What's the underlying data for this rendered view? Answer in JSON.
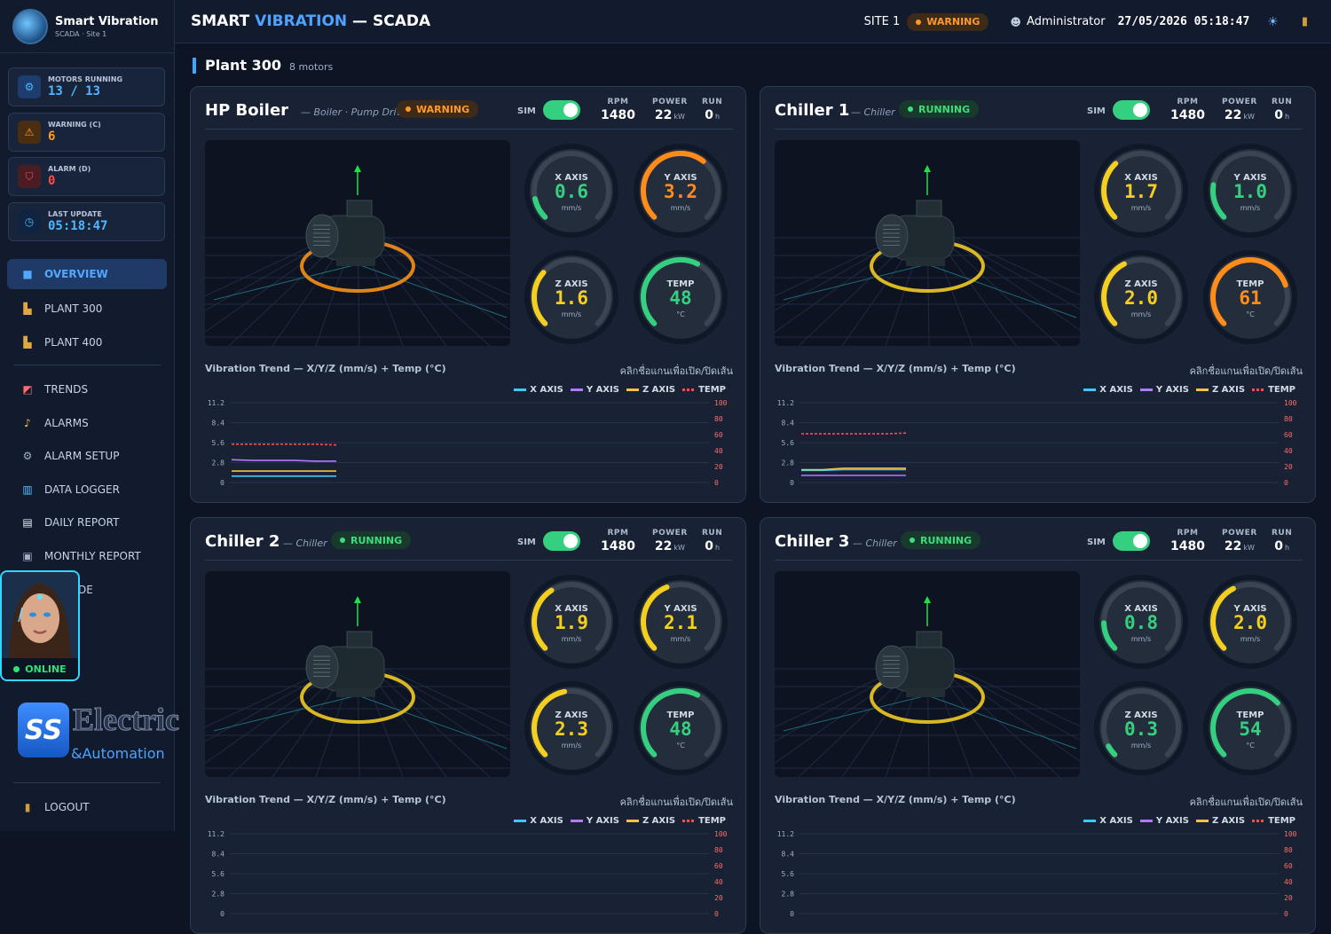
{
  "brand": {
    "title": "Smart Vibration",
    "subtitle": "SCADA · Site 1"
  },
  "stats": [
    {
      "label": "MOTORS RUNNING",
      "value": "13 / 13",
      "color": "#4fb6ff",
      "icon": "gear-icon"
    },
    {
      "label": "WARNING (C)",
      "value": "6",
      "color": "#ff9a2a",
      "icon": "warning-icon"
    },
    {
      "label": "ALARM (D)",
      "value": "0",
      "color": "#ff4a4a",
      "icon": "shield-icon"
    },
    {
      "label": "LAST UPDATE",
      "value": "05:18:47",
      "color": "#4fb6ff",
      "icon": "clock-icon"
    }
  ],
  "nav": [
    {
      "label": "OVERVIEW",
      "icon": "overview-icon"
    },
    {
      "label": "PLANT 300",
      "icon": "factory-icon"
    },
    {
      "label": "PLANT 400",
      "icon": "factory-icon"
    },
    {
      "label": "TRENDS",
      "icon": "trend-chart-icon"
    },
    {
      "label": "ALARMS",
      "icon": "bell-icon"
    },
    {
      "label": "ALARM SETUP",
      "icon": "gear-icon"
    },
    {
      "label": "DATA LOGGER",
      "icon": "bar-chart-icon"
    },
    {
      "label": "DAILY REPORT",
      "icon": "document-icon"
    },
    {
      "label": "MONTHLY REPORT",
      "icon": "calendar-icon"
    },
    {
      "label": "DE",
      "icon": ""
    }
  ],
  "assistant": {
    "status": "ONLINE"
  },
  "company": {
    "mark": "SS",
    "name": "Electric",
    "sub": "&Automation"
  },
  "logout": "LOGOUT",
  "topbar": {
    "title_a": "SMART ",
    "title_b": "VIBRATION",
    "title_c": " — SCADA",
    "site": "SITE 1",
    "status": "WARNING",
    "user": "Administrator",
    "datetime": "27/05/2026 05:18:47"
  },
  "section": {
    "title": "Plant 300",
    "subtitle": "8 motors"
  },
  "labels": {
    "sim": "SIM",
    "rpm": "RPM",
    "power": "POWER",
    "run": "RUN",
    "kw": "kW",
    "h": "h",
    "trend_title": "Vibration Trend — X/Y/Z (mm/s) + Temp (°C)",
    "trend_hint": "คลิกชื่อแกนเพื่อเปิด/ปิดเส้น",
    "x": "X AXIS",
    "y": "Y AXIS",
    "z": "Z AXIS",
    "temp": "TEMP",
    "mms": "mm/s",
    "degc": "°C"
  },
  "colors": {
    "green": "#35d07f",
    "yellow": "#f5cf1f",
    "orange": "#ff8c1a",
    "x": "#3ec8ff",
    "y": "#b27bff",
    "z": "#f5c242",
    "t": "#ff4a4a"
  },
  "chart_axes": {
    "left_ticks": [
      "11.2",
      "8.4",
      "5.6",
      "2.8",
      "0"
    ],
    "right_ticks": [
      "100",
      "80",
      "60",
      "40",
      "20",
      "0"
    ]
  },
  "motors": [
    {
      "name": "HP Boiler",
      "type": "— Boiler · Pump Drive",
      "status": "WARNING",
      "rpm": "1480",
      "power": "22",
      "run": "0",
      "x": "0.6",
      "y": "3.2",
      "z": "1.6",
      "temp": "48",
      "ring": "orange",
      "chart_data": {
        "type": "line",
        "y_range": [
          0,
          11.2
        ],
        "y2_range": [
          0,
          100
        ],
        "series": [
          {
            "name": "X AXIS",
            "values": [
              0.9,
              0.9,
              0.9,
              0.9,
              0.9,
              0.9
            ]
          },
          {
            "name": "Y AXIS",
            "values": [
              3.2,
              3.1,
              3.1,
              3.1,
              3.0,
              3.0
            ]
          },
          {
            "name": "Z AXIS",
            "values": [
              1.6,
              1.6,
              1.6,
              1.6,
              1.6,
              1.6
            ]
          },
          {
            "name": "TEMP",
            "values": [
              48,
              48,
              48,
              48,
              48,
              47
            ]
          }
        ]
      }
    },
    {
      "name": "Chiller 1",
      "type": "— Chiller",
      "status": "RUNNING",
      "rpm": "1480",
      "power": "22",
      "run": "0",
      "x": "1.7",
      "y": "1.0",
      "z": "2.0",
      "temp": "61",
      "ring": "yellow",
      "chart_data": {
        "type": "line",
        "y_range": [
          0,
          11.2
        ],
        "y2_range": [
          0,
          100
        ],
        "series": [
          {
            "name": "X AXIS",
            "values": [
              1.7,
              1.7,
              1.8,
              1.8,
              1.8,
              1.8
            ]
          },
          {
            "name": "Y AXIS",
            "values": [
              1.0,
              1.0,
              1.0,
              1.0,
              1.0,
              1.0
            ]
          },
          {
            "name": "Z AXIS",
            "values": [
              1.8,
              1.8,
              2.0,
              2.0,
              2.0,
              2.0
            ]
          },
          {
            "name": "TEMP",
            "values": [
              61,
              61,
              61,
              61,
              61,
              62
            ]
          }
        ]
      }
    },
    {
      "name": "Chiller 2",
      "type": "— Chiller",
      "status": "RUNNING",
      "rpm": "1480",
      "power": "22",
      "run": "0",
      "x": "1.9",
      "y": "2.1",
      "z": "2.3",
      "temp": "48",
      "ring": "yellow"
    },
    {
      "name": "Chiller 3",
      "type": "— Chiller",
      "status": "RUNNING",
      "rpm": "1480",
      "power": "22",
      "run": "0",
      "x": "0.8",
      "y": "2.0",
      "z": "0.3",
      "temp": "54",
      "ring": "yellow"
    }
  ]
}
